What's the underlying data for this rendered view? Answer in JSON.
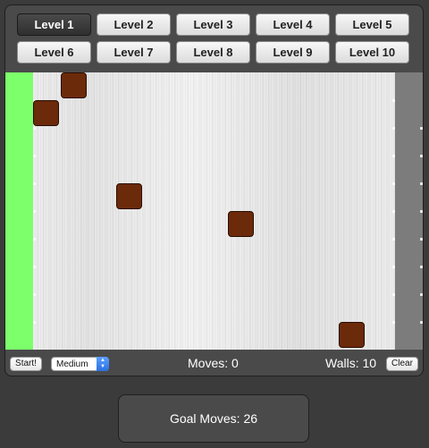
{
  "levels": [
    {
      "label": "Level 1",
      "active": true
    },
    {
      "label": "Level 2",
      "active": false
    },
    {
      "label": "Level 3",
      "active": false
    },
    {
      "label": "Level 4",
      "active": false
    },
    {
      "label": "Level 5",
      "active": false
    },
    {
      "label": "Level 6",
      "active": false
    },
    {
      "label": "Level 7",
      "active": false
    },
    {
      "label": "Level 8",
      "active": false
    },
    {
      "label": "Level 9",
      "active": false
    },
    {
      "label": "Level 10",
      "active": false
    }
  ],
  "controls": {
    "start_label": "Start!",
    "speed_value": "Medium",
    "moves_text": "Moves: 0",
    "walls_text": "Walls: 10",
    "clear_label": "Clear"
  },
  "goal": {
    "text": "Goal Moves: 26"
  },
  "colors": {
    "start_zone": "#7cff6b",
    "goal_zone": "#7c7c7c",
    "block": "#6b2a0a"
  }
}
